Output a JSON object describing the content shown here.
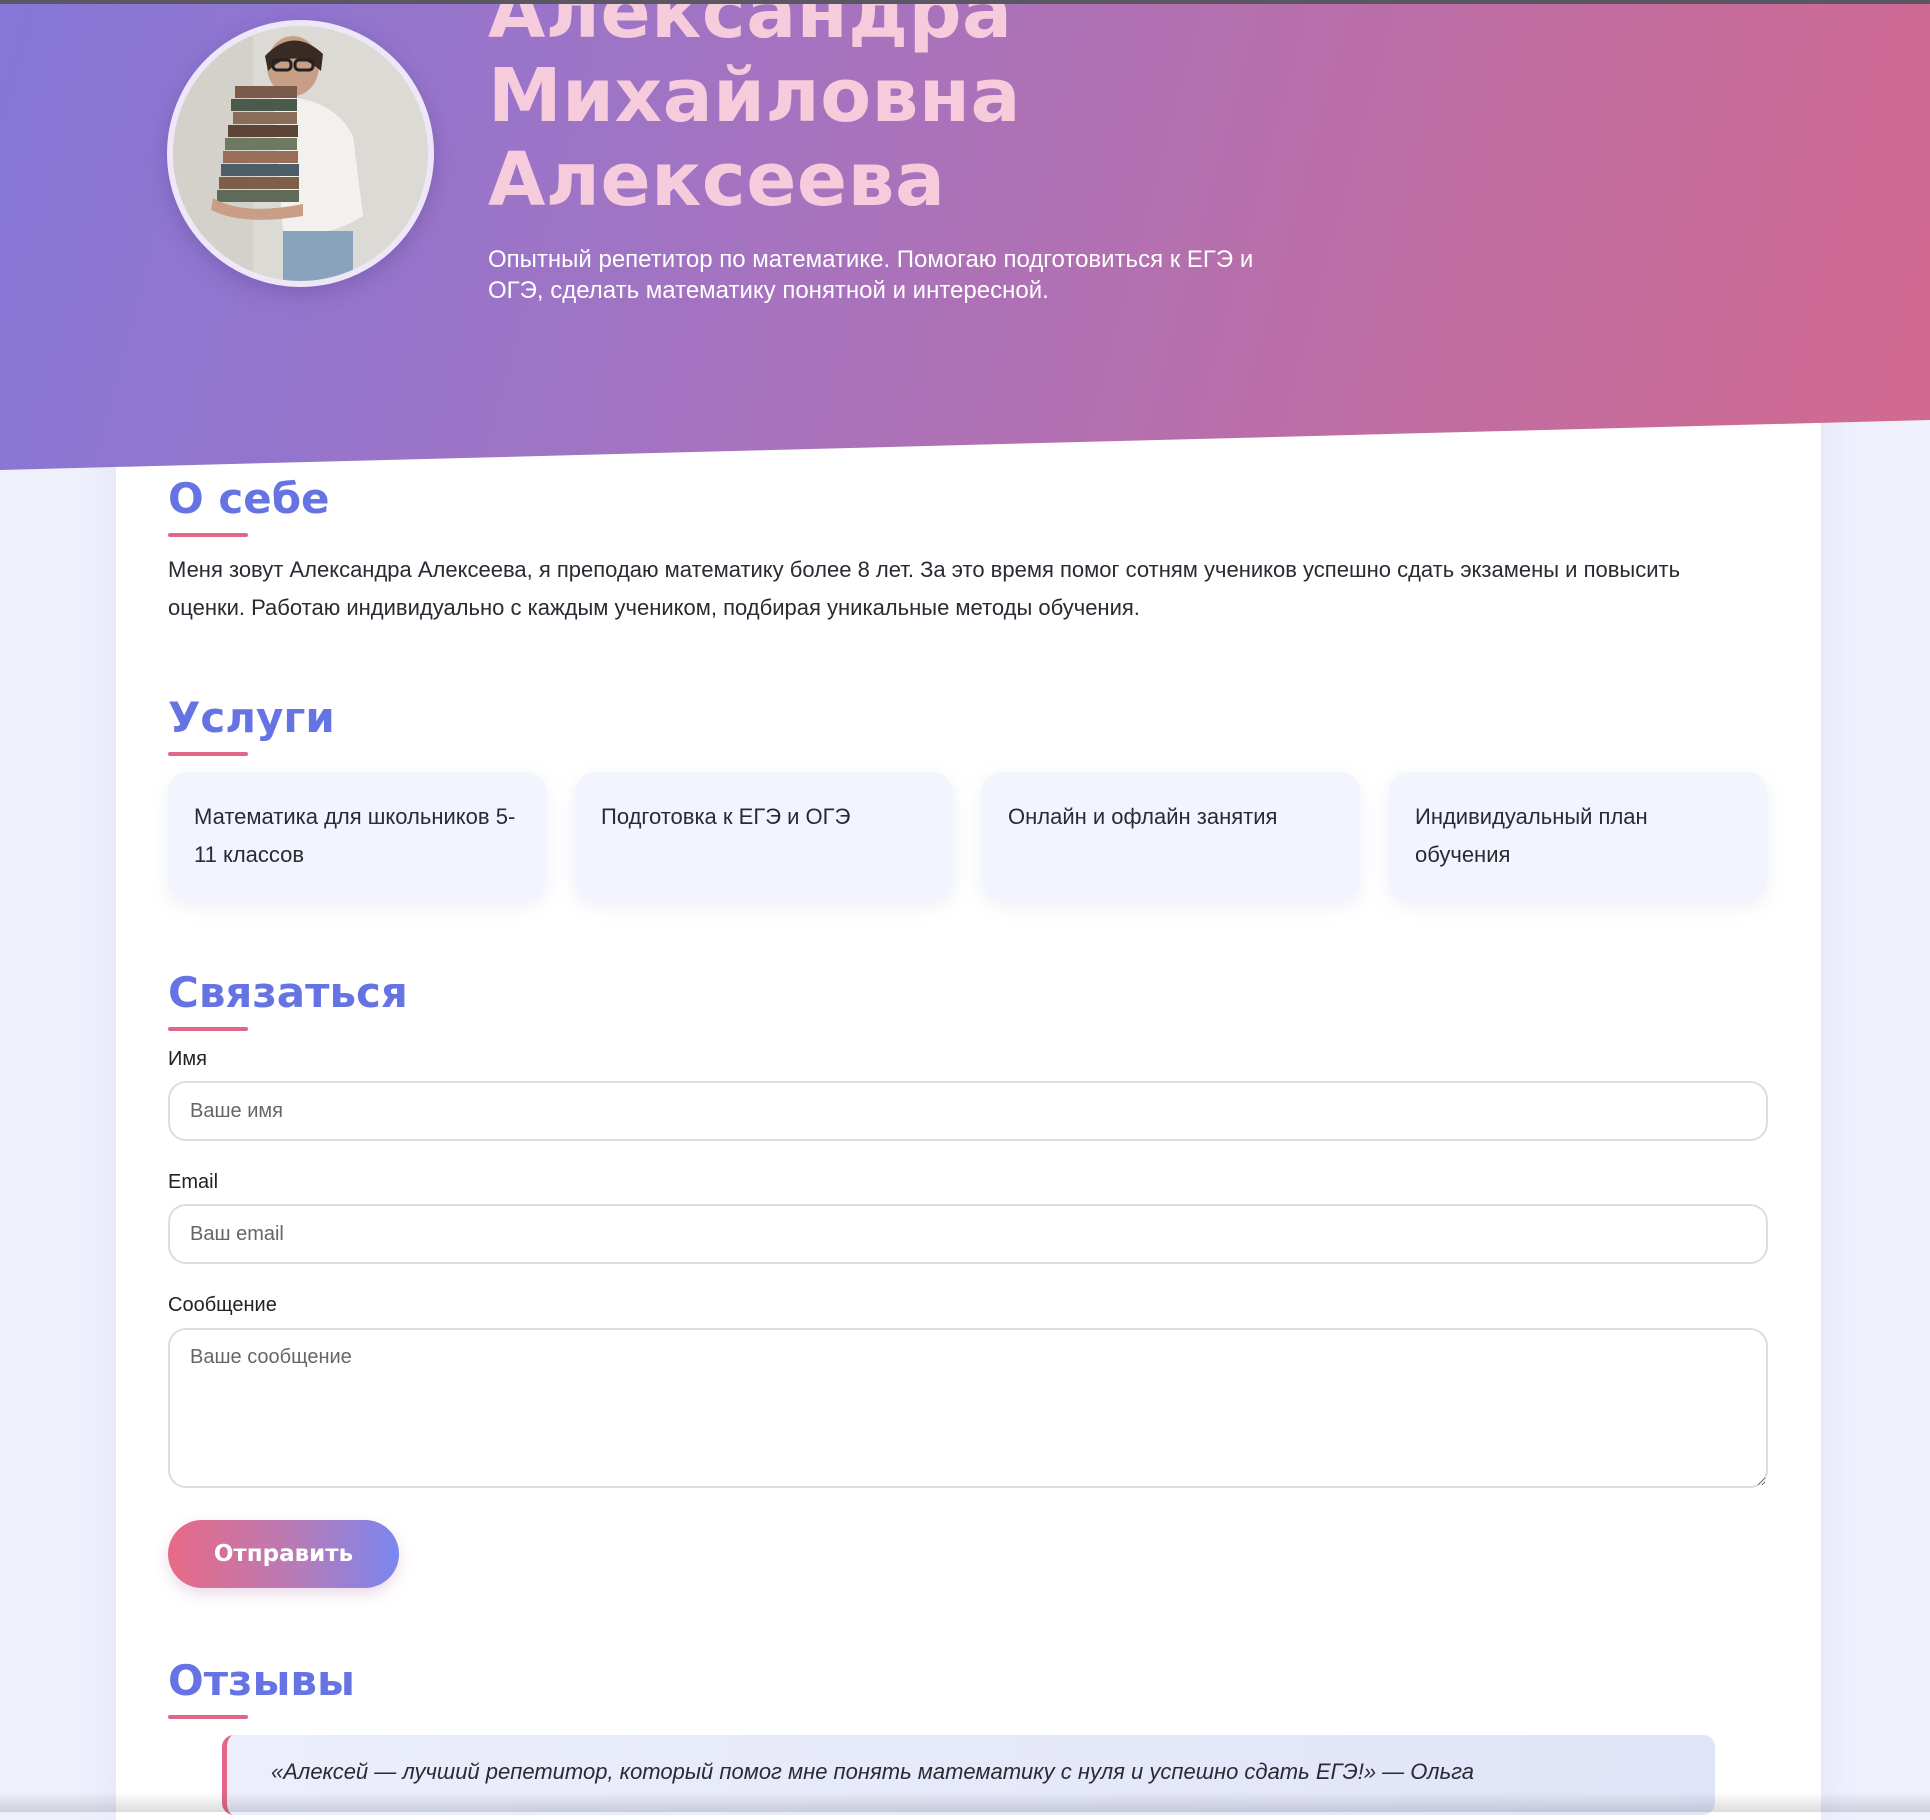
{
  "hero": {
    "name_line_1": "Александра",
    "name_line_2": "Михайловна",
    "name_line_3": "Алексеева",
    "subtitle": "Опытный репетитор по математике. Помогаю подготовиться к ЕГЭ и ОГЭ, сделать математику понятной и интересной."
  },
  "about": {
    "title": "О себе",
    "text": "Меня зовут Александра Алексеева, я преподаю математику более 8 лет. За это время помог сотням учеников успешно сдать экзамены и повысить оценки. Работаю индивидуально с каждым учеником, подбирая уникальные методы обучения."
  },
  "services": {
    "title": "Услуги",
    "items": [
      {
        "label": "Математика для школьников 5-11 классов"
      },
      {
        "label": "Подготовка к ЕГЭ и ОГЭ"
      },
      {
        "label": "Онлайн и офлайн занятия"
      },
      {
        "label": "Индивидуальный план обучения"
      }
    ]
  },
  "contact": {
    "title": "Связаться",
    "name_label": "Имя",
    "name_placeholder": "Ваше имя",
    "email_label": "Email",
    "email_placeholder": "Ваш email",
    "message_label": "Сообщение",
    "message_placeholder": "Ваше сообщение",
    "submit_label": "Отправить"
  },
  "reviews": {
    "title": "Отзывы",
    "items": [
      {
        "text": "«Алексей — лучший репетитор, который помог мне понять математику с нуля и успешно сдать ЕГЭ!» — Ольга"
      }
    ]
  },
  "colors": {
    "hero_gradient_start": "#8577d8",
    "hero_gradient_end": "#d2698f",
    "heading": "#6673e3",
    "accent": "#e26687",
    "hero_name": "#f6cbdc",
    "service_card_bg": "#f3f5fe"
  }
}
